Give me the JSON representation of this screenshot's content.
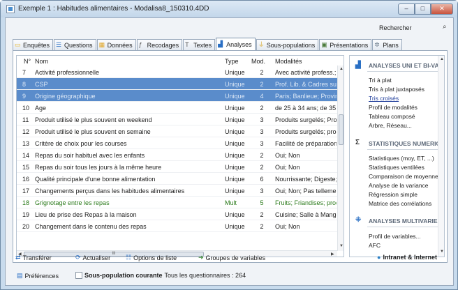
{
  "window": {
    "title": "Exemple 1 : Habitudes alimentaires - Modalisa8_150310.4DD",
    "min": "–",
    "max": "□",
    "close": "✕"
  },
  "search": {
    "label": "Rechercher"
  },
  "tabs": [
    {
      "label": "Enquêtes",
      "icon": "folder-icon",
      "color": "#e8b730"
    },
    {
      "label": "Questions",
      "icon": "list-icon",
      "color": "#3d7cc9"
    },
    {
      "label": "Données",
      "icon": "table-icon",
      "color": "#e2a82c"
    },
    {
      "label": "Recodages",
      "icon": "fx-icon",
      "color": "#555555"
    },
    {
      "label": "Textes",
      "icon": "text-icon",
      "color": "#555555"
    },
    {
      "label": "Analyses",
      "icon": "bar-chart-icon",
      "color": "#2a6fc4"
    },
    {
      "label": "Sous-populations",
      "icon": "funnel-icon",
      "color": "#d9a521"
    },
    {
      "label": "Présentations",
      "icon": "presentation-icon",
      "color": "#4a7a3a"
    },
    {
      "label": "Plans",
      "icon": "gear-icon",
      "color": "#6a7a8a"
    }
  ],
  "grid": {
    "headers": {
      "num": "N°",
      "nom": "Nom",
      "type": "Type",
      "mod": "Mod.",
      "modalites": "Modalités"
    },
    "rows": [
      {
        "num": "7",
        "nom": "Activité professionnelle",
        "type": "Unique",
        "mod": "2",
        "modalites": "Avec activité profess.;"
      },
      {
        "num": "8",
        "nom": "CSP",
        "type": "Unique",
        "mod": "2",
        "modalites": "Prof. Lib. & Cadres sup"
      },
      {
        "num": "9",
        "nom": "Origine géographique",
        "type": "Unique",
        "mod": "4",
        "modalites": "Paris; Banlieue; Provin"
      },
      {
        "num": "10",
        "nom": "Age",
        "type": "Unique",
        "mod": "2",
        "modalites": "de 25 à 34 ans; de 35"
      },
      {
        "num": "11",
        "nom": "Produit utilisé le plus souvent en weekend",
        "type": "Unique",
        "mod": "3",
        "modalites": "Produits surgelés; Prod"
      },
      {
        "num": "12",
        "nom": "Produit utilisé le plus souvent en semaine",
        "type": "Unique",
        "mod": "3",
        "modalites": "Produits surgelés; prod"
      },
      {
        "num": "13",
        "nom": "Critère de choix pour les courses",
        "type": "Unique",
        "mod": "3",
        "modalites": "Facilité de préparation;"
      },
      {
        "num": "14",
        "nom": "Repas du soir habituel avec les enfants",
        "type": "Unique",
        "mod": "2",
        "modalites": "Oui; Non"
      },
      {
        "num": "15",
        "nom": "Repas du soir tous les jours à la même heure",
        "type": "Unique",
        "mod": "2",
        "modalites": "Oui; Non"
      },
      {
        "num": "16",
        "nom": "Qualité principale d'une bonne alimentation",
        "type": "Unique",
        "mod": "6",
        "modalites": "Nourrissante; Digeste;"
      },
      {
        "num": "17",
        "nom": "Changements perçus dans les habitudes alimentaires",
        "type": "Unique",
        "mod": "3",
        "modalites": "Oui; Non; Pas tellemen"
      },
      {
        "num": "18",
        "nom": "Grignotage entre les repas",
        "type": "Mult",
        "mod": "5",
        "modalites": "Fruits; Friandises; produ"
      },
      {
        "num": "19",
        "nom": "Lieu de prise des Repas à la maison",
        "type": "Unique",
        "mod": "2",
        "modalites": "Cuisine; Salle à Mange"
      },
      {
        "num": "20",
        "nom": "Changement dans le contenu des repas",
        "type": "Unique",
        "mod": "2",
        "modalites": "Oui; Non"
      }
    ],
    "hscroll_label": "III"
  },
  "right": {
    "sections": [
      {
        "title": "ANALYSES UNI ET BI-VAR",
        "icon": "bar-chart-icon",
        "items": [
          "Tri à plat",
          "Tris à plat juxtaposés",
          "Tris croisés",
          "Profil de modalités",
          "Tableau composé",
          "Arbre, Réseau..."
        ]
      },
      {
        "title": "STATISTIQUES NUMERIQ",
        "icon": "sigma-icon",
        "items": [
          "Statistiques (moy, ET, ...)",
          "Statistiques ventilées",
          "Comparaison de moyennes",
          "Analyse de la variance",
          "Régression simple",
          "Matrice des corrélations"
        ]
      },
      {
        "title": "ANALYSES MULTIVARIEES",
        "icon": "scatter-icon",
        "items": [
          "Profil de variables...",
          "AFC"
        ]
      }
    ]
  },
  "toolbar": {
    "transfer": "Transférer",
    "refresh": "Actualiser",
    "list_options": "Options de liste",
    "var_groups": "Groupes de variables",
    "intranet": "Intranet & Internet"
  },
  "status": {
    "prefs": "Préférences",
    "subpop": "Sous-population courante",
    "count": "Tous les questionnaires : 264"
  },
  "colors": {
    "selection": "#5a8ccb",
    "green_row": "#2a7a1a"
  }
}
